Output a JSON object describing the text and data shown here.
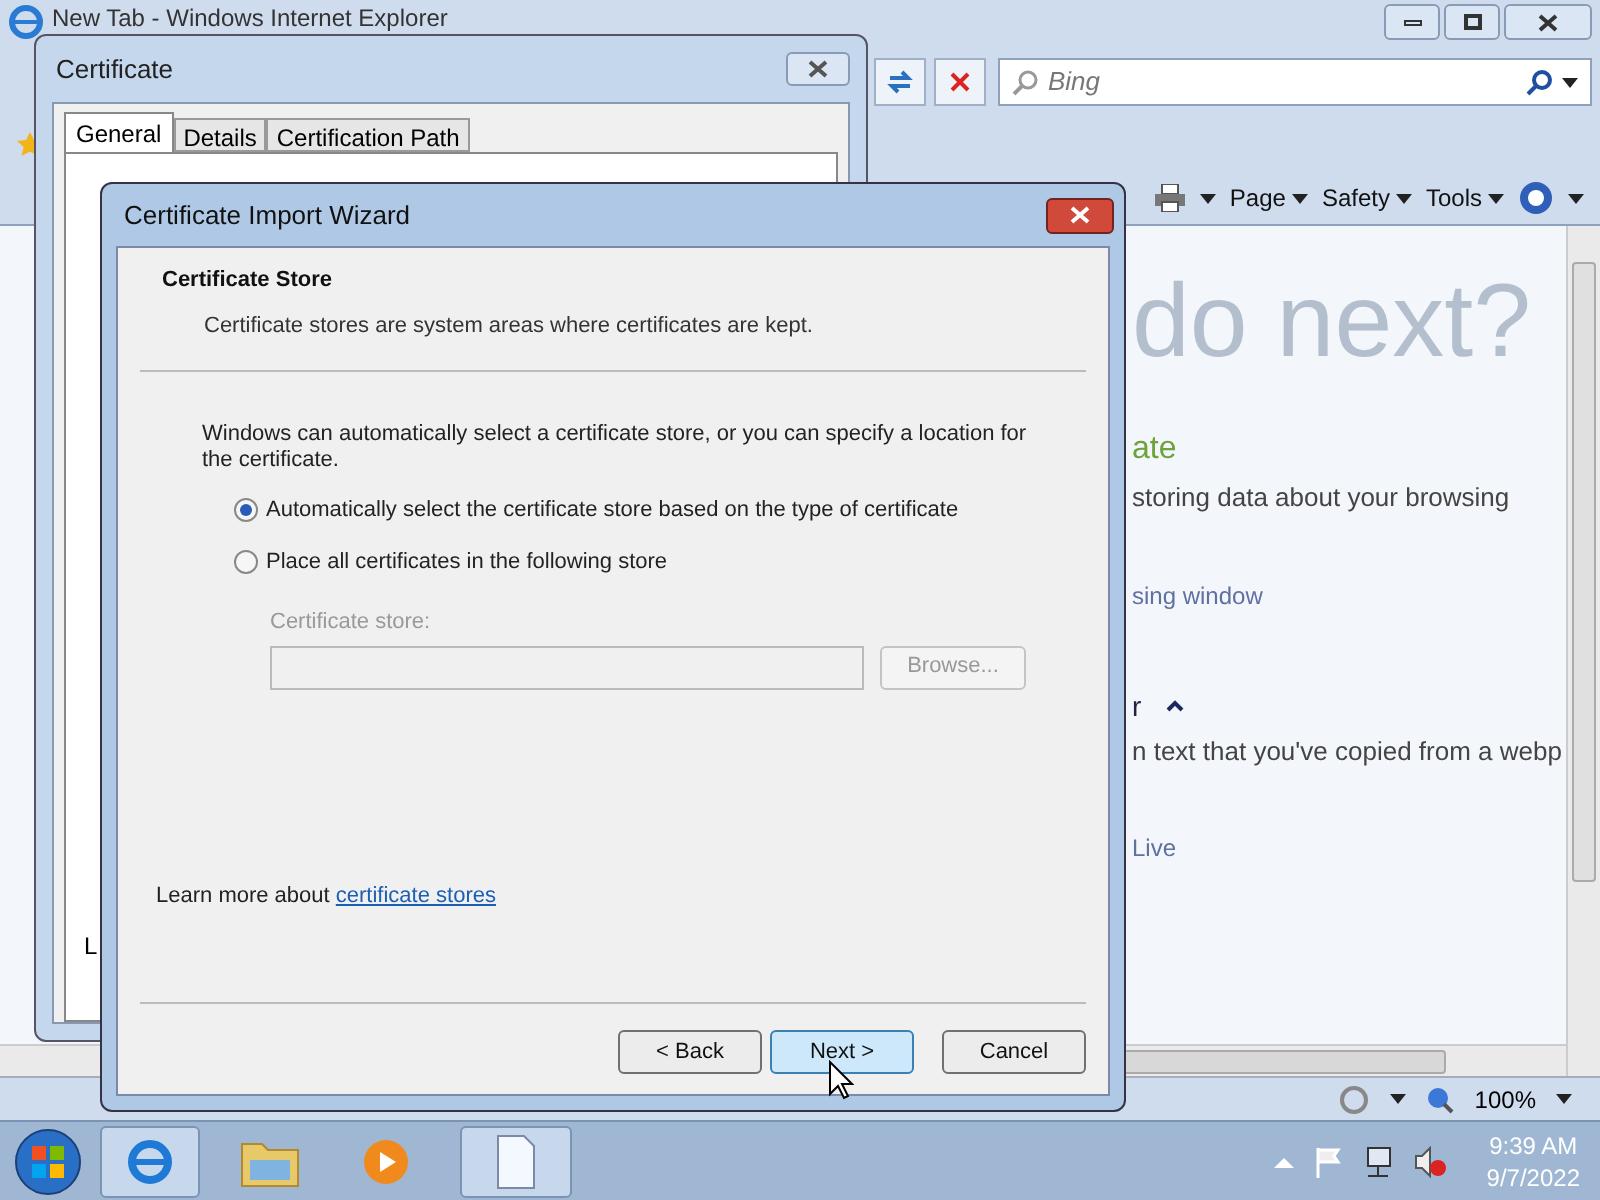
{
  "browser": {
    "title": "New Tab - Windows Internet Explorer",
    "search": {
      "placeholder": "Bing"
    },
    "command_bar": [
      "Page",
      "Safety",
      "Tools"
    ],
    "content": [
      {
        "kind": "big",
        "text": "do next?"
      },
      {
        "kind": "title",
        "text": "ate"
      },
      {
        "kind": "text",
        "text": "storing data about your browsing"
      },
      {
        "kind": "link",
        "text": "sing window"
      },
      {
        "kind": "section",
        "text": "r"
      },
      {
        "kind": "text",
        "text": "n text that you've copied from a webp"
      },
      {
        "kind": "link",
        "text": "Live"
      }
    ],
    "zoom": "100%"
  },
  "certificate_dialog": {
    "title": "Certificate",
    "tabs": [
      {
        "label": "General",
        "selected": true
      },
      {
        "label": "Details",
        "selected": false
      },
      {
        "label": "Certification Path",
        "selected": false
      }
    ],
    "fragment": "L"
  },
  "wizard": {
    "title": "Certificate Import Wizard",
    "header_title": "Certificate Store",
    "header_subtitle": "Certificate stores are system areas where certificates are kept.",
    "intro": "Windows can automatically select a certificate store, or you can specify a location for the certificate.",
    "options": [
      {
        "label": "Automatically select the certificate store based on the type of certificate",
        "selected": true
      },
      {
        "label": "Place all certificates in the following store",
        "selected": false
      }
    ],
    "store_label": "Certificate store:",
    "browse": {
      "label": "Browse...",
      "disabled": true
    },
    "learn_more": "Learn more about ",
    "learn_more_link": "certificate stores",
    "buttons": [
      {
        "label": "< Back",
        "default": false
      },
      {
        "label": "Next >",
        "default": true
      },
      {
        "label": "Cancel",
        "default": false
      }
    ]
  },
  "taskbar": {
    "time": "9:39 AM",
    "date": "9/7/2022"
  }
}
